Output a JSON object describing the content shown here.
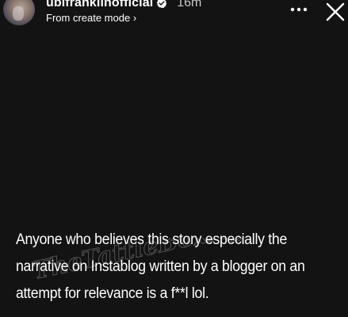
{
  "story": {
    "header": {
      "username": "ubifranklinofficial",
      "time": "16m",
      "subtitle": "From create mode ›",
      "more_label": "More options",
      "close_label": "Close"
    },
    "text": "Anyone who believes this story especially the narrative on Instablog written by a blogger on an attempt for relevance is a f**l lol.",
    "watermark": "TheTattleBoxNg"
  },
  "colors": {
    "background": "#131313",
    "text": "#ffffff",
    "verified_badge": "#ffffff"
  }
}
